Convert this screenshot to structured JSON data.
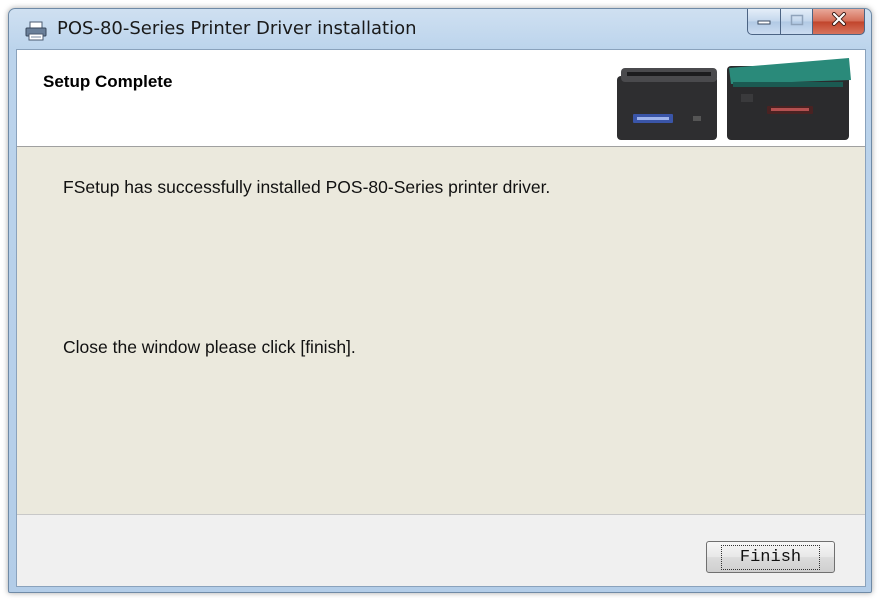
{
  "window": {
    "title": "POS-80-Series Printer Driver installation",
    "icons": {
      "app": "printer-icon",
      "minimize": "minimize-icon",
      "maximize": "maximize-icon",
      "close": "close-icon"
    }
  },
  "header": {
    "title": "Setup Complete",
    "image": "receipt-printers-image"
  },
  "body": {
    "message_success": "FSetup has successfully installed POS-80-Series printer driver.",
    "message_close": "Close the window please click [finish]."
  },
  "footer": {
    "finish_label": "Finish"
  },
  "colors": {
    "body_background": "#ebe9dd",
    "close_button": "#c1442b",
    "titlebar": "#bcd4ec"
  }
}
